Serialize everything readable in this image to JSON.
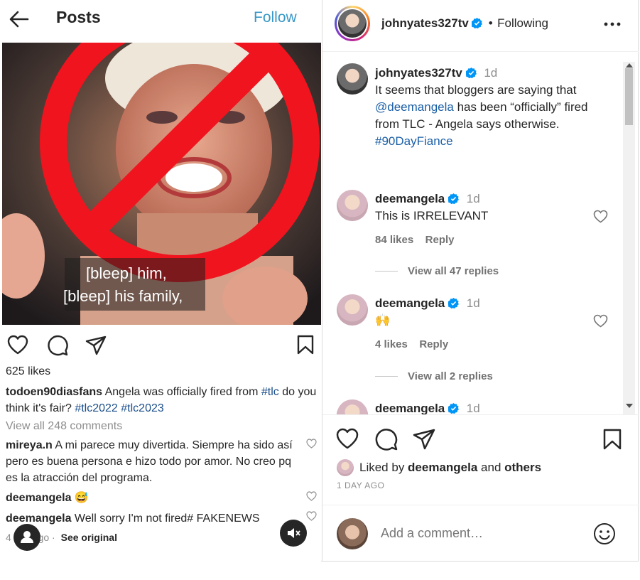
{
  "left": {
    "title": "Posts",
    "follow_label": "Follow",
    "photo_caption_line1": "[bleep] him,",
    "photo_caption_line2": "[bleep] his family,",
    "likes": "625 likes",
    "caption_user": "todoen90diasfans",
    "caption_text": " Angela was officially fired from ",
    "caption_tag1": "#tlc",
    "caption_text2": " do you think it's fair? ",
    "caption_tag2": "#tlc2022",
    "caption_tag3": "#tlc2023",
    "view_all": "View all 248 comments",
    "comments": [
      {
        "user": "mireya.n",
        "text": " A mi parece muy divertida. Siempre ha sido así pero es buena persona e hizo todo por amor. No creo pq es la atracción del programa."
      },
      {
        "user": "deemangela",
        "text": " 😅"
      },
      {
        "user": "deemangela",
        "text": " Well sorry I'm not fired# FAKENEWS"
      }
    ],
    "meta_time": "4",
    "meta_ago": "ago",
    "see_original": "See original"
  },
  "right": {
    "header_user": "johnyates327tv",
    "header_status": "Following",
    "post_user": "johnyates327tv",
    "post_time": "1d",
    "post_text1": "It seems that bloggers are saying that",
    "post_mention": "@deemangela",
    "post_text2": " has been “officially” fired from TLC - Angela says otherwise.",
    "post_tag": "#90DayFiance",
    "comments": [
      {
        "user": "deemangela",
        "time": "1d",
        "text": "This is IRRELEVANT",
        "likes": "84 likes",
        "reply": "Reply",
        "view_replies": "View all 47 replies"
      },
      {
        "user": "deemangela",
        "time": "1d",
        "text": "🙌",
        "likes": "4 likes",
        "reply": "Reply",
        "view_replies": "View all 2 replies"
      },
      {
        "user": "deemangela",
        "time": "1d"
      }
    ],
    "liked_by_prefix": "Liked by ",
    "liked_by_user": "deemangela",
    "liked_by_and": " and ",
    "liked_by_others": "others",
    "days_ago": "1 DAY AGO",
    "add_comment_placeholder": "Add a comment…"
  },
  "colors": {
    "link": "#1b5fa6",
    "follow": "#3897c7",
    "verified": "#0095f6",
    "nosign": "#f0141e"
  }
}
